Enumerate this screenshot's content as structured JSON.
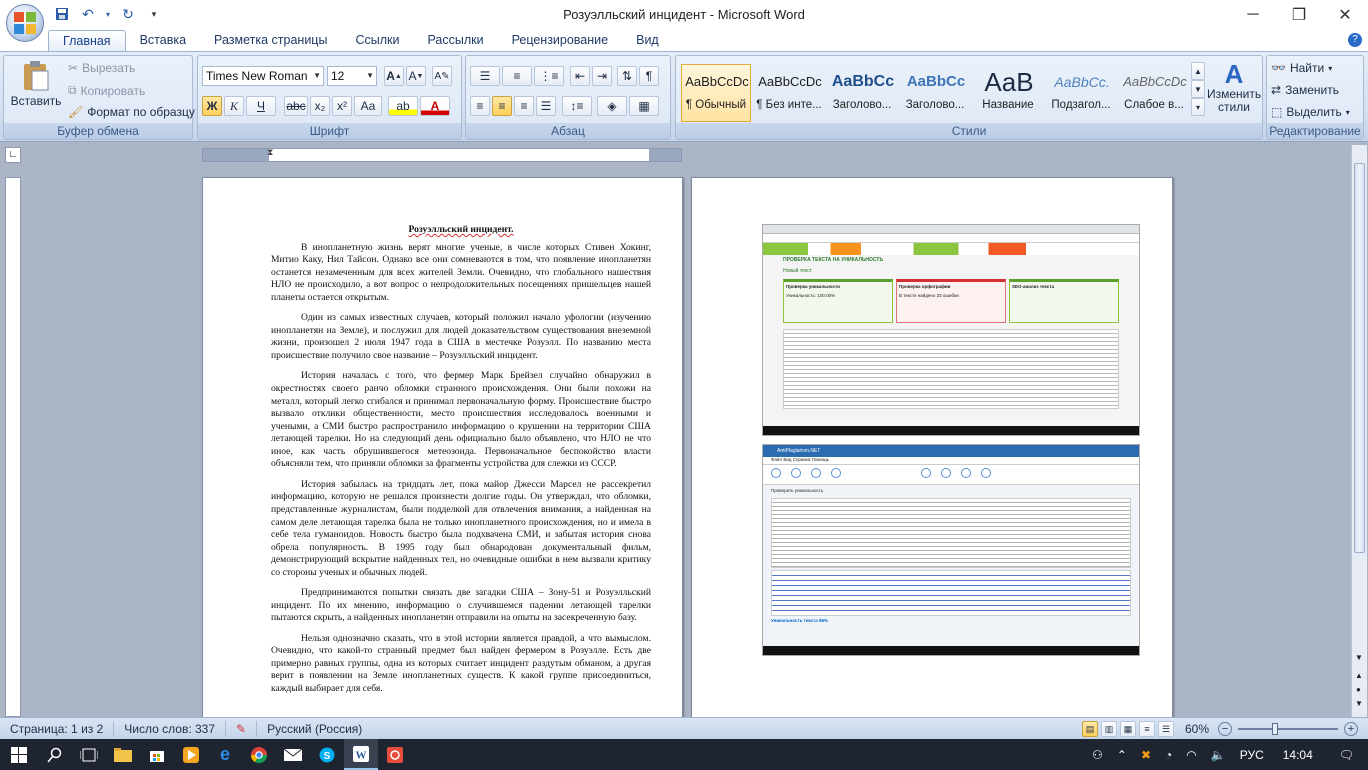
{
  "window": {
    "title": "Розуэлльский инцидент - Microsoft Word"
  },
  "tabs": [
    "Главная",
    "Вставка",
    "Разметка страницы",
    "Ссылки",
    "Рассылки",
    "Рецензирование",
    "Вид"
  ],
  "clipboard": {
    "label": "Буфер обмена",
    "paste": "Вставить",
    "cut": "Вырезать",
    "copy": "Копировать",
    "format_painter": "Формат по образцу"
  },
  "font": {
    "label": "Шрифт",
    "family": "Times New Roman",
    "size": "12",
    "bold": "Ж",
    "italic": "К",
    "underline": "Ч",
    "strike": "abc",
    "sub": "x₂",
    "sup": "x²",
    "case": "Aa"
  },
  "paragraph": {
    "label": "Абзац"
  },
  "styles": {
    "label": "Стили",
    "items": [
      {
        "preview": "AaBbCcDc",
        "name": "¶ Обычный"
      },
      {
        "preview": "AaBbCcDc",
        "name": "¶ Без инте..."
      },
      {
        "preview": "AaBbCc",
        "name": "Заголово..."
      },
      {
        "preview": "AaBbCc",
        "name": "Заголово..."
      },
      {
        "preview": "AaB",
        "name": "Название"
      },
      {
        "preview": "AaBbCc.",
        "name": "Подзагол..."
      },
      {
        "preview": "AaBbCcDc",
        "name": "Слабое в..."
      }
    ],
    "change": "Изменить стили"
  },
  "editing": {
    "label": "Редактирование",
    "find": "Найти",
    "replace": "Заменить",
    "select": "Выделить"
  },
  "document": {
    "title": "Розуэлльский инцидент.",
    "paragraphs": [
      "В инопланетную жизнь верят многие ученые, в числе которых Стивен Хокинг, Митио Каку, Нил Тайсон. Однако все они сомневаются в том, что появление инопланетян останется незамеченным для всех жителей Земли. Очевидно, что глобального нашествия НЛО не происходило, а вот вопрос о непродолжительных посещениях пришельцев нашей планеты остается открытым.",
      "Один из самых известных случаев, который положил начало уфологии (изучению инопланетян на Земле), и послужил для людей доказательством существования внеземной жизни, произошел 2 июля 1947 года в США в местечке Розуэлл. По названию места происшествие получило свое название – Розуэлльский инцидент.",
      "История началась с того, что фермер Марк Брейзел случайно обнаружил в окрестностях своего ранчо обломки странного происхождения. Они были похожи на металл, который легко сгибался и принимал первоначальную форму. Происшествие быстро вызвало отклики общественности, место происшествия исследовалось военными и учеными, а СМИ быстро распространило информацию о крушении на территории США летающей тарелки. Но на следующий день официально было объявлено, что НЛО не что иное, как часть обрушившегося метеозонда. Первоначальное беспокойство власти объясняли тем, что приняли обломки за фрагменты устройства для слежки из СССР.",
      "История забылась на тридцать лет, пока майор Джесси Марсел не рассекретил информацию, которую не решался произнести долгие годы. Он утверждал, что обломки, представленные журналистам, были подделкой для отвлечения внимания, а найденная на самом деле летающая тарелка была не только инопланетного происхождения, но и имела в себе тела гуманоидов. Новость быстро была подхвачена СМИ, и забытая история снова обрела популярность. В 1995 году был обнародован документальный фильм, демонстрирующий вскрытие найденных тел, но очевидные ошибки в нем вызвали критику со стороны ученых и обычных людей.",
      "Предпринимаются попытки связать две загадки США – Зону-51 и Розуэлльский инцидент. По их мнению, информацию о случившемся падении летающей тарелки пытаются скрыть, а найденных инопланетян отправили на опыты на засекреченную базу.",
      "Нельзя однозначно сказать, что в этой истории является правдой, а что вымыслом. Очевидно, что какой-то странный предмет был найден фермером в Розуэлле. Есть две примерно равных группы, одна из которых считает инцидент раздутым обманом, а другая верит в появлении на Земле инопланетных существ. К какой группе присоединиться, каждый выбирает для себя."
    ]
  },
  "screenshot1": {
    "heading": "ПРОВЕРКА ТЕКСТА НА УНИКАЛЬНОСТЬ",
    "new_text": "Новый текст",
    "uniq_title": "Проверка уникальности",
    "uniq_value": "Уникальность: 100.00%",
    "spell_title": "Проверка орфографии",
    "spell_value": "В тексте найдено 33 ошибки",
    "seo_title": "SEO-анализ текста"
  },
  "screenshot2": {
    "title": "AntiPlagiarism.NET",
    "menu": "Файл  Вид  Справка  Помощь",
    "check_btn": "Проверить уникальность",
    "result": "Уникальность текста 96%"
  },
  "status": {
    "page": "Страница: 1 из 2",
    "words": "Число слов: 337",
    "language": "Русский (Россия)",
    "zoom": "60%"
  },
  "taskbar": {
    "lang": "РУС",
    "time": "14:04"
  }
}
